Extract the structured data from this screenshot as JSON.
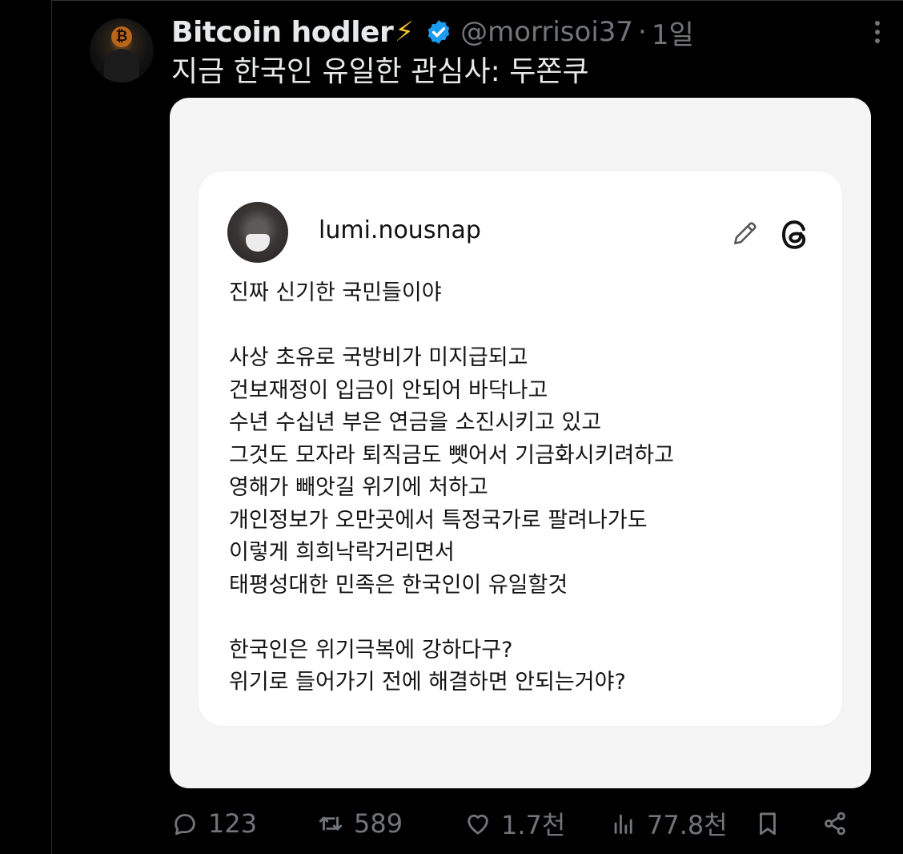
{
  "tweet": {
    "display_name": "Bitcoin hodler",
    "bolt": "⚡",
    "handle": "@morrisoi37",
    "separator": "·",
    "time": "1일",
    "text": "지금 한국인 유일한 관심사: 두쫀쿠"
  },
  "embedded_card": {
    "username": "lumi.nousnap",
    "lines": [
      "진짜 신기한 국민들이야",
      "",
      "사상 초유로 국방비가 미지급되고",
      "건보재정이 입금이 안되어 바닥나고",
      "수년 수십년 부은 연금을 소진시키고 있고",
      "그것도 모자라 퇴직금도 뺏어서 기금화시키려하고",
      "영해가 빼앗길 위기에 처하고",
      "개인정보가 오만곳에서 특정국가로 팔려나가도",
      "이렇게 희희낙락거리면서",
      "태평성대한 민족은 한국인이 유일할것",
      "",
      "한국인은 위기극복에 강하다구?",
      "위기로 들어가기 전에 해결하면 안되는거야?"
    ]
  },
  "actions": {
    "replies": "123",
    "retweets": "589",
    "likes": "1.7천",
    "views": "77.8천"
  },
  "colors": {
    "background": "#000000",
    "text_primary": "#e7e9ea",
    "text_secondary": "#71767b",
    "verified_badge": "#1d9bf0",
    "bolt": "#f7c52a"
  },
  "icons": [
    "verified-badge-icon",
    "more-icon",
    "pencil-icon",
    "threads-logo-icon",
    "reply-icon",
    "retweet-icon",
    "like-icon",
    "views-icon",
    "bookmark-icon",
    "share-icon"
  ]
}
